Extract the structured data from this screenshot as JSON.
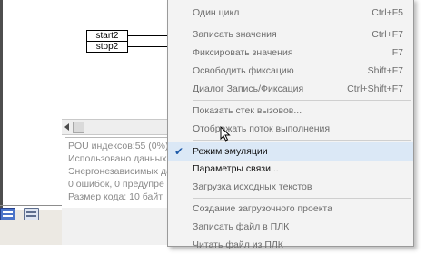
{
  "diagram": {
    "var_start": "start2",
    "var_stop": "stop2"
  },
  "messages": [
    "POU индексов:55 (0%)",
    "Использовано данных:",
    "Энергонезависимых да",
    "0 ошибок, 0 предупре",
    "Размер кода: 10 байт"
  ],
  "menu": {
    "items": [
      {
        "label": "Один цикл",
        "shortcut": "Ctrl+F5",
        "enabled": false
      },
      {
        "label": "Записать значения",
        "shortcut": "Ctrl+F7",
        "enabled": false
      },
      {
        "label": "Фиксировать значения",
        "shortcut": "F7",
        "enabled": false
      },
      {
        "label": "Освободить фиксацию",
        "shortcut": "Shift+F7",
        "enabled": false
      },
      {
        "label": "Диалог Запись/Фиксация",
        "shortcut": "Ctrl+Shift+F7",
        "enabled": false
      },
      {
        "label": "Показать стек вызовов...",
        "shortcut": "",
        "enabled": false
      },
      {
        "label": "Отображать поток выполнения",
        "shortcut": "",
        "enabled": false
      },
      {
        "label": "Режим эмуляции",
        "shortcut": "",
        "enabled": true,
        "checked": true
      },
      {
        "label": "Параметры связи...",
        "shortcut": "",
        "enabled": true
      },
      {
        "label": "Загрузка исходных текстов",
        "shortcut": "",
        "enabled": false
      },
      {
        "label": "Создание загрузочного проекта",
        "shortcut": "",
        "enabled": false
      },
      {
        "label": "Записать файл в ПЛК",
        "shortcut": "",
        "enabled": false
      },
      {
        "label": "Читать файл из ПЛК",
        "shortcut": "",
        "enabled": false
      }
    ]
  },
  "icons": {
    "check": "check-icon",
    "cursor": "mouse-cursor-icon"
  },
  "colors": {
    "menu_background": "#f3f3f3",
    "checked_highlight": "#dbe8f6",
    "disabled_text": "#6d6d6d"
  }
}
